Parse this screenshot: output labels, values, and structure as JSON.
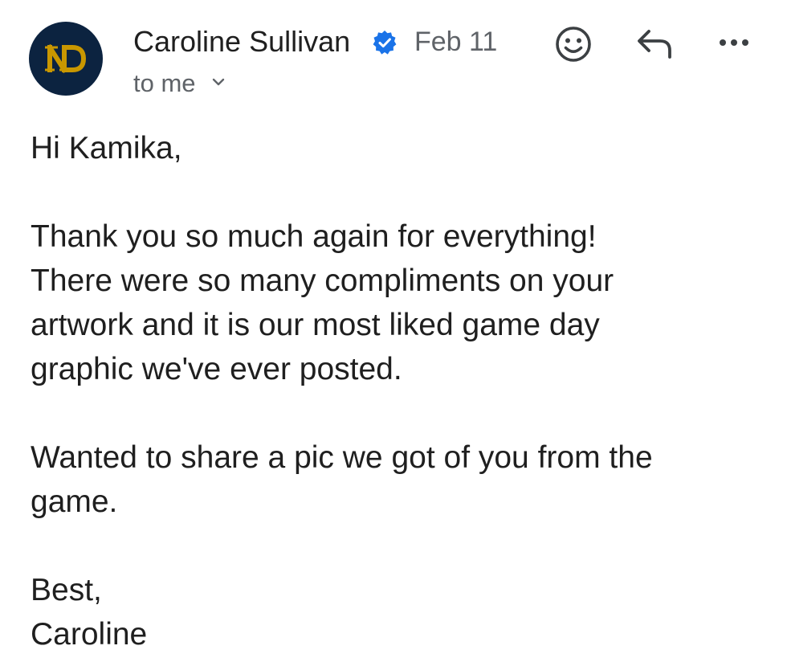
{
  "header": {
    "sender_name": "Caroline Sullivan",
    "date": "Feb 11",
    "recipient": "to me",
    "avatar_icon": "nd-logo-icon",
    "verified_icon": "verified-badge-icon",
    "actions": {
      "emoji_icon": "smiley-emoji-icon",
      "reply_icon": "reply-arrow-icon",
      "more_icon": "more-dots-icon"
    }
  },
  "message": {
    "greeting": "Hi Kamika,",
    "paragraph1_lines": [
      "Thank you so much again for everything!",
      "There were so many compliments on your",
      "artwork and it is our most liked game day",
      "graphic we've ever posted."
    ],
    "paragraph2_lines": [
      "Wanted to share a pic we got of you from the",
      "game."
    ],
    "signoff": "Best,",
    "signature": "Caroline"
  },
  "colors": {
    "avatar_bg": "#0c2340",
    "avatar_gold": "#c99700",
    "verified_blue": "#1a73e8",
    "secondary_text": "#5f6368",
    "primary_text": "#1f1f1f"
  }
}
